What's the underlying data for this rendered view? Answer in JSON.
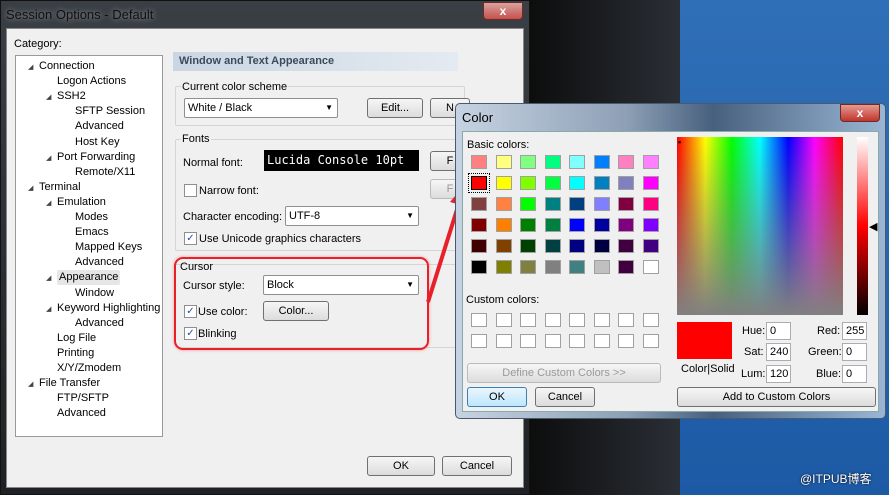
{
  "main": {
    "title": "Session Options - Default",
    "close": "x",
    "category_label": "Category:",
    "tree": [
      {
        "label": "Connection",
        "level": 0,
        "expander": true
      },
      {
        "label": "Logon Actions",
        "level": 1,
        "expander": false
      },
      {
        "label": "SSH2",
        "level": 1,
        "expander": true
      },
      {
        "label": "SFTP Session",
        "level": 2,
        "expander": false
      },
      {
        "label": "Advanced",
        "level": 2,
        "expander": false
      },
      {
        "label": "Host Key",
        "level": 2,
        "expander": false
      },
      {
        "label": "Port Forwarding",
        "level": 1,
        "expander": true
      },
      {
        "label": "Remote/X11",
        "level": 2,
        "expander": false
      },
      {
        "label": "Terminal",
        "level": 0,
        "expander": true
      },
      {
        "label": "Emulation",
        "level": 1,
        "expander": true
      },
      {
        "label": "Modes",
        "level": 2,
        "expander": false
      },
      {
        "label": "Emacs",
        "level": 2,
        "expander": false
      },
      {
        "label": "Mapped Keys",
        "level": 2,
        "expander": false
      },
      {
        "label": "Advanced",
        "level": 2,
        "expander": false
      },
      {
        "label": "Appearance",
        "level": 1,
        "expander": true,
        "selected": true
      },
      {
        "label": "Window",
        "level": 2,
        "expander": false
      },
      {
        "label": "Keyword Highlighting",
        "level": 1,
        "expander": true
      },
      {
        "label": "Advanced",
        "level": 2,
        "expander": false
      },
      {
        "label": "Log File",
        "level": 1,
        "expander": false
      },
      {
        "label": "Printing",
        "level": 1,
        "expander": false
      },
      {
        "label": "X/Y/Zmodem",
        "level": 1,
        "expander": false
      },
      {
        "label": "File Transfer",
        "level": 0,
        "expander": true
      },
      {
        "label": "FTP/SFTP",
        "level": 1,
        "expander": false
      },
      {
        "label": "Advanced",
        "level": 1,
        "expander": false
      }
    ],
    "panel_title": "Window and Text Appearance",
    "scheme": {
      "label": "Current color scheme",
      "value": "White / Black",
      "edit": "Edit...",
      "new": "N"
    },
    "fonts": {
      "label": "Fonts",
      "normal_font_label": "Normal font:",
      "normal_font_value": "Lucida Console 10pt",
      "font_btn": "F",
      "narrow_font_label": "Narrow font:",
      "narrow_checked": false,
      "narrow_btn": "F",
      "encoding_label": "Character encoding:",
      "encoding_value": "UTF-8",
      "unicode_label": "Use Unicode graphics characters",
      "unicode_checked": true
    },
    "cursor": {
      "label": "Cursor",
      "style_label": "Cursor style:",
      "style_value": "Block",
      "use_color_label": "Use color:",
      "use_color_checked": true,
      "color_btn": "Color...",
      "blinking_label": "Blinking",
      "blinking_checked": true
    },
    "ok": "OK",
    "cancel": "Cancel"
  },
  "color_dialog": {
    "title": "Color",
    "close": "x",
    "basic_label": "Basic colors:",
    "basic_colors": [
      "#FF8080",
      "#FFFF80",
      "#80FF80",
      "#00FF80",
      "#80FFFF",
      "#0080FF",
      "#FF80C0",
      "#FF80FF",
      "#FF0000",
      "#FFFF00",
      "#80FF00",
      "#00FF40",
      "#00FFFF",
      "#0080C0",
      "#8080C0",
      "#FF00FF",
      "#804040",
      "#FF8040",
      "#00FF00",
      "#008080",
      "#004080",
      "#8080FF",
      "#800040",
      "#FF0080",
      "#800000",
      "#FF8000",
      "#008000",
      "#008040",
      "#0000FF",
      "#0000A0",
      "#800080",
      "#8000FF",
      "#400000",
      "#804000",
      "#004000",
      "#004040",
      "#000080",
      "#000040",
      "#400040",
      "#400080",
      "#000000",
      "#808000",
      "#808040",
      "#808080",
      "#408080",
      "#C0C0C0",
      "#400040",
      "#FFFFFF"
    ],
    "selected_index": 8,
    "custom_label": "Custom colors:",
    "define_btn": "Define Custom Colors >>",
    "ok": "OK",
    "cancel": "Cancel",
    "solid_label": "Color|Solid",
    "current_color": "#FF0000",
    "hue_label": "Hue:",
    "hue": "0",
    "sat_label": "Sat:",
    "sat": "240",
    "lum_label": "Lum:",
    "lum": "120",
    "red_label": "Red:",
    "red": "255",
    "green_label": "Green:",
    "green": "0",
    "blue_label": "Blue:",
    "blue": "0",
    "add_btn": "Add to Custom Colors"
  },
  "annotation": {
    "color": "#E8202A"
  },
  "watermark": "@ITPUB博客"
}
